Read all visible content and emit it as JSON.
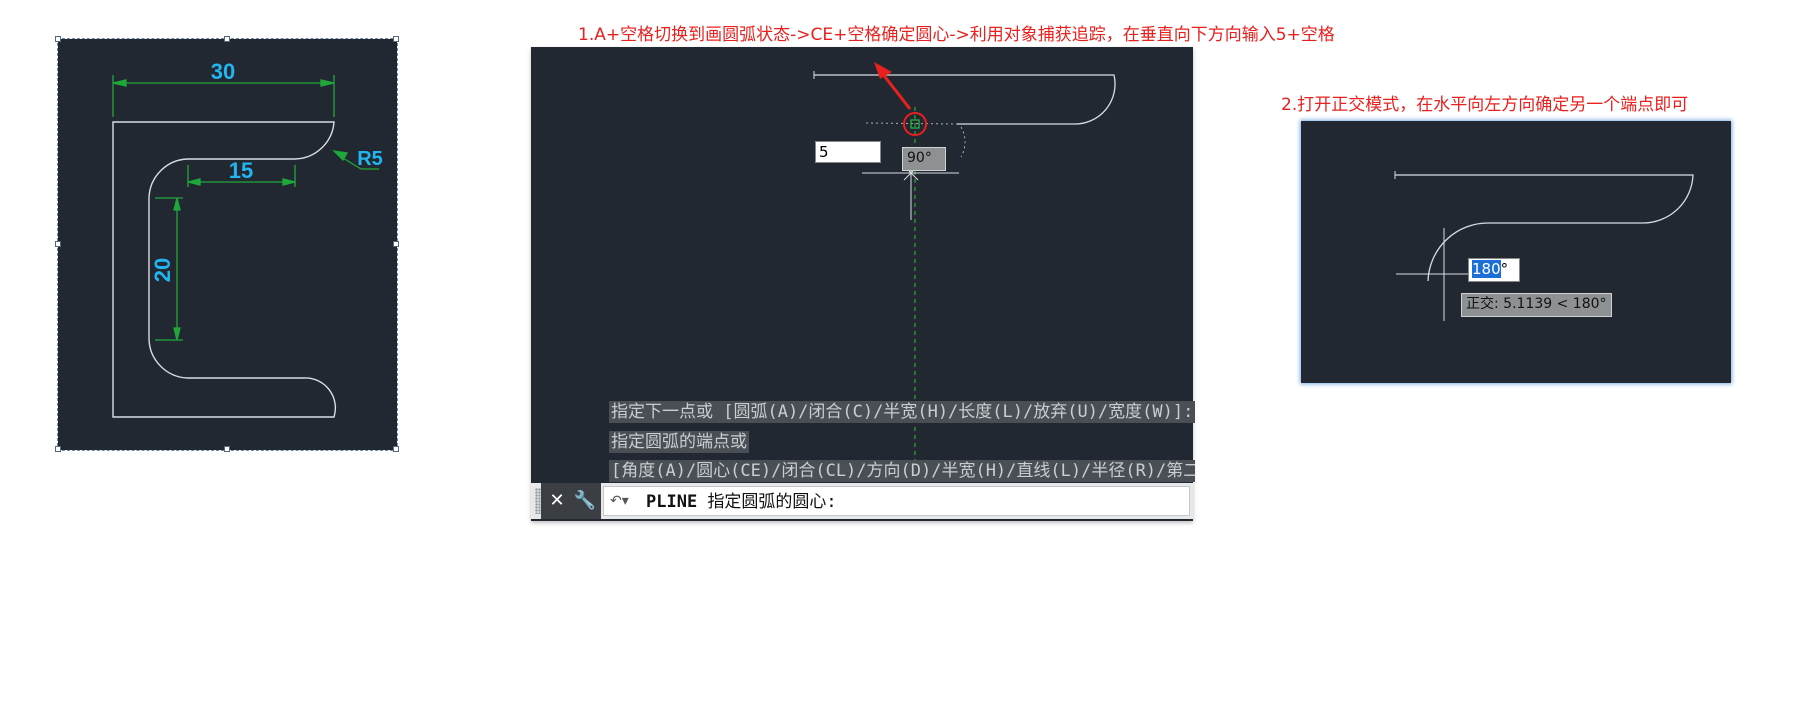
{
  "panel1": {
    "dimensions": {
      "top_width": "30",
      "inner_width": "15",
      "inner_height": "20",
      "fillet_radius": "R5"
    }
  },
  "step1": {
    "caption": "1.A+空格切换到画圆弧状态->CE+空格确定圆心->利用对象捕获追踪，在垂直向下方向输入5+空格",
    "dyn_input_value": "5",
    "angle_tooltip": "90°",
    "command_history": [
      "指定下一点或 [圆弧(A)/闭合(C)/半宽(H)/长度(L)/放弃(U)/宽度(W)]:",
      "指定圆弧的端点或",
      "[角度(A)/圆心(CE)/闭合(CL)/方向(D)/半宽(H)/直线(L)/半径(R)/第二个点(S)/放弃(U)/宽度(W)]:"
    ],
    "command_line": {
      "command": "PLINE",
      "prompt": "指定圆弧的圆心:"
    },
    "icons": [
      "close-icon",
      "wrench-icon",
      "command-prompt-icon"
    ]
  },
  "step2": {
    "caption": "2.打开正交模式，在水平向左方向确定另一个端点即可",
    "angle_input_selected": "180",
    "angle_input_suffix": "°",
    "ortho_tooltip": "正交: 5.1139 < 180°"
  },
  "colors": {
    "cad_background": "#212832",
    "caption_red": "#e8201e",
    "dimension_green": "#1fa83a",
    "dimension_text_cyan": "#22b5f0",
    "selection_blue": "#1d6fd8"
  }
}
